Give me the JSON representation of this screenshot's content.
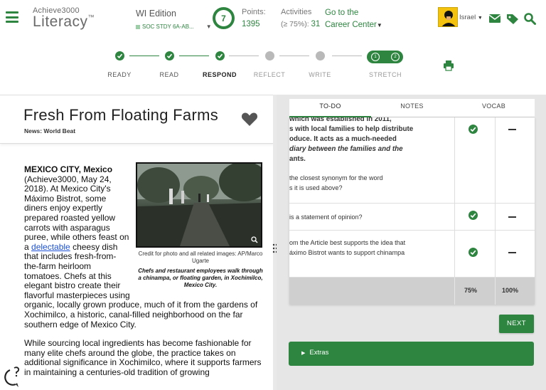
{
  "header": {
    "logo_top": "Achieve3000",
    "logo_main": "Literacy",
    "logo_tm": "™",
    "edition": "WI Edition",
    "class_name": "SOC STDY 6A-AB...",
    "level": "7",
    "points_label": "Points:",
    "points_value": "1395",
    "activities_label": "Activities",
    "activities_prefix": "(≥ 75%):",
    "activities_value": "31",
    "career_line1": "Go to the",
    "career_line2": "Career Center",
    "user_name": "Israel",
    "icons": [
      "menu-icon",
      "mail-icon",
      "tag-icon",
      "search-icon"
    ]
  },
  "steps": [
    {
      "label": "READY",
      "state": "done"
    },
    {
      "label": "READ",
      "state": "done"
    },
    {
      "label": "RESPOND",
      "state": "current"
    },
    {
      "label": "REFLECT",
      "state": "todo"
    },
    {
      "label": "WRITE",
      "state": "todo"
    },
    {
      "label": "STRETCH",
      "state": "todo",
      "sub": [
        "1",
        "2"
      ]
    }
  ],
  "article": {
    "title": "Fresh From Floating Farms",
    "category": "News: World Beat",
    "dateline": "MEXICO CITY, Mexico",
    "p1_a": "(Achieve3000, May 24, 2018). At Mexico City's Máximo Bistrot, some diners enjoy expertly prepared roasted yellow carrots with asparagus puree, while others feast on a ",
    "p1_link": "delectable",
    "p1_b": " cheesy dish that includes fresh-from-the-farm heirloom tomatoes. Chefs at this elegant bistro create their flavorful masterpieces using organic, locally grown produce, much of it from the gardens of Xochimilco, a historic, canal-filled neighborhood on the far southern edge of Mexico City.",
    "p2": "While sourcing local ingredients has become fashionable for many elite chefs around the globe, the practice takes on additional significance in Xochimilco, where it supports farmers in maintaining a centuries-old tradition of growing",
    "photo_credit": "Credit for photo and all related images: AP/Marco Ugarte",
    "photo_caption": "Chefs and restaurant employees walk through a chinampa, or floating garden, in Xochimilco, Mexico City."
  },
  "tabs": [
    {
      "label": "TO-DO",
      "active": true
    },
    {
      "label": "NOTES",
      "active": false
    },
    {
      "label": "VOCAB",
      "active": false
    }
  ],
  "questions": [
    {
      "lines": [
        {
          "t": "which was established in 2011,",
          "b": true
        },
        {
          "t": "s with local families to help distribute",
          "b": true
        },
        {
          "t": "oduce. It acts as a much-needed",
          "b": true
        },
        {
          "t": "diary between the families and the",
          "b": true,
          "i": true
        },
        {
          "t": "ants.",
          "b": true
        },
        {
          "t": "",
          "b": false
        },
        {
          "t": "the closest synonym for the word",
          "b": false
        },
        {
          "t": "s it is used above?",
          "b": false
        }
      ],
      "correct": true,
      "dash": true
    },
    {
      "lines": [
        {
          "t": "is a statement of opinion?",
          "b": false
        }
      ],
      "correct": true,
      "dash": true
    },
    {
      "lines": [
        {
          "t": "om the Article best supports the idea that",
          "b": false
        },
        {
          "t": "áximo Bistrot wants to support chinampa",
          "b": false
        }
      ],
      "correct": true,
      "dash": true
    }
  ],
  "score_first": "75%",
  "score_best": "100%",
  "next_label": "NEXT",
  "extras_label": "Extras",
  "colors": {
    "brand_green": "#2e8540",
    "gray_dot": "#b9b9b9"
  }
}
